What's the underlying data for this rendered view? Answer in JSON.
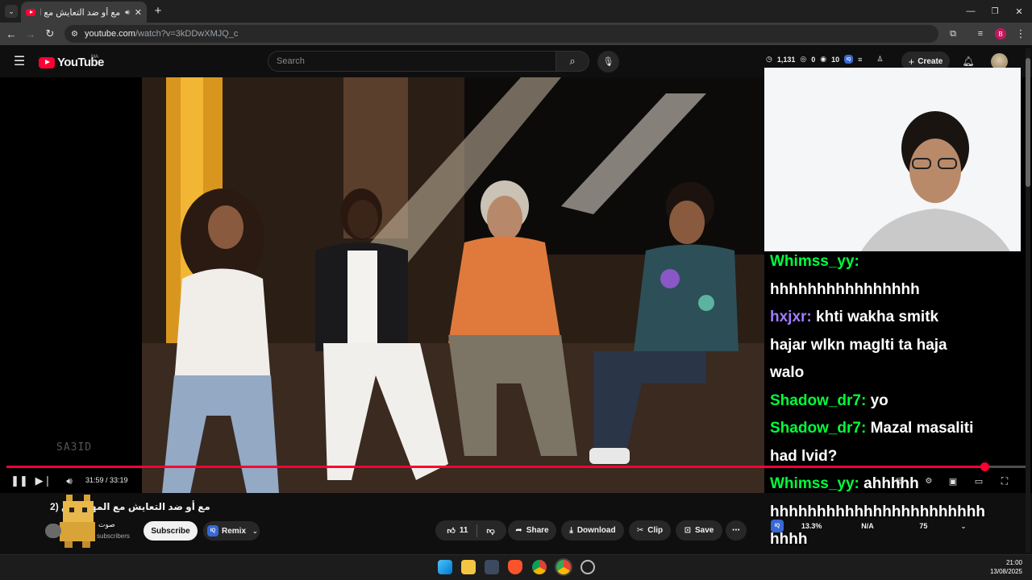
{
  "browser": {
    "tab_title": "مع أو ضد التعايش مع المهاجرين",
    "url_host": "youtube.com",
    "url_path": "/watch?v=3kDDwXMJQ_c",
    "new_tab_icon": "plus-icon",
    "close_tab_icon": "close-icon"
  },
  "youtube": {
    "logo_text": "YouTube",
    "country_code": "MA",
    "search_placeholder": "Search",
    "stats": {
      "views": "1,131",
      "count_a": "0",
      "count_b": "10"
    },
    "create_label": "Create"
  },
  "player": {
    "current_time": "31:59",
    "duration": "33:19",
    "time_display": "31:59 / 33:19",
    "progress_fraction": 0.96,
    "watermark": "SA3ID"
  },
  "chat": [
    {
      "user": "Whimss_yy:",
      "message": "",
      "user_color": "#00ff3c"
    },
    {
      "user": "",
      "message": "hhhhhhhhhhhhhhhh",
      "user_color": "#ffffff"
    },
    {
      "user": "hxjxr:",
      "message": "khti wakha smitk",
      "user_color": "#a07cff"
    },
    {
      "user": "",
      "message": "hajar wlkn maglti ta haja",
      "user_color": "#ffffff"
    },
    {
      "user": "",
      "message": "walo",
      "user_color": "#ffffff"
    },
    {
      "user": "Shadow_dr7:",
      "message": "yo",
      "user_color": "#00ff3c"
    },
    {
      "user": "Shadow_dr7:",
      "message": "Mazal masaliti",
      "user_color": "#00ff3c"
    },
    {
      "user": "",
      "message": "had lvid?",
      "user_color": "#ffffff"
    },
    {
      "user": "Whimss_yy:",
      "message": "ahhhhh",
      "user_color": "#00ff3c"
    },
    {
      "user": "",
      "message": "hhhhhhhhhhhhhhhhhhhhhhh",
      "user_color": "#ffffff"
    },
    {
      "user": "",
      "message": "hhhh",
      "user_color": "#ffffff"
    }
  ],
  "video_info": {
    "title": "مع أو ضد التعايش مع المهاجرين (2",
    "channel": "صوت",
    "subscribers": "subscribers",
    "subscribe_label": "Subscribe",
    "remix_label": "Remix",
    "likes": "11",
    "share_label": "Share",
    "download_label": "Download",
    "clip_label": "Clip",
    "save_label": "Save"
  },
  "iq_extension": {
    "badge": "IQ",
    "value_1": "13.3%",
    "value_2": "N/A",
    "value_3": "75"
  },
  "taskbar": {
    "time": "21:00",
    "date": "13/08/2025"
  },
  "colors": {
    "youtube_red": "#ff0033",
    "chat_green": "#00ff3c",
    "chat_purple": "#a07cff",
    "iq_blue": "#3869d4"
  }
}
